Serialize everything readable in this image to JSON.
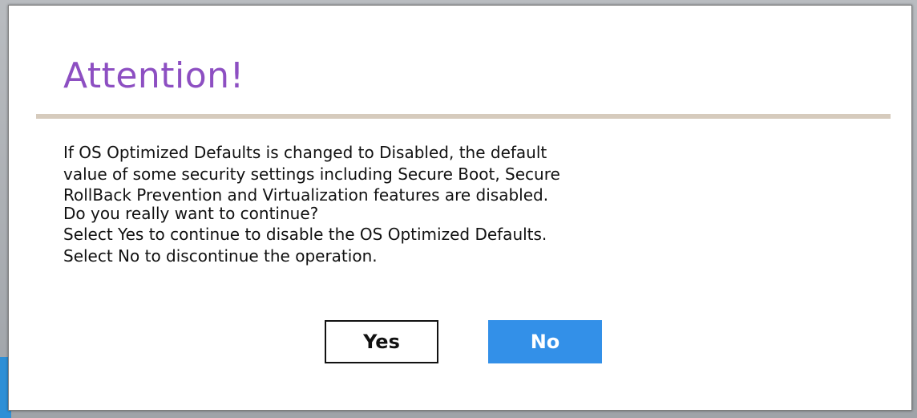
{
  "dialog": {
    "title": "Attention!",
    "message_lines": [
      "If OS Optimized Defaults is changed to Disabled, the default",
      "value of some security settings including Secure Boot, Secure",
      "RollBack Prevention and Virtualization features are disabled.",
      "Do you really want to continue?",
      "Select Yes to continue to disable the OS Optimized Defaults.",
      "Select No  to discontinue the operation."
    ],
    "yes_label": "Yes",
    "no_label": "No"
  },
  "colors": {
    "title": "#8d4fc2",
    "divider": "#d6cbbd",
    "no_button_bg": "#3390e8",
    "backdrop_accent": "#2e8fd6"
  }
}
